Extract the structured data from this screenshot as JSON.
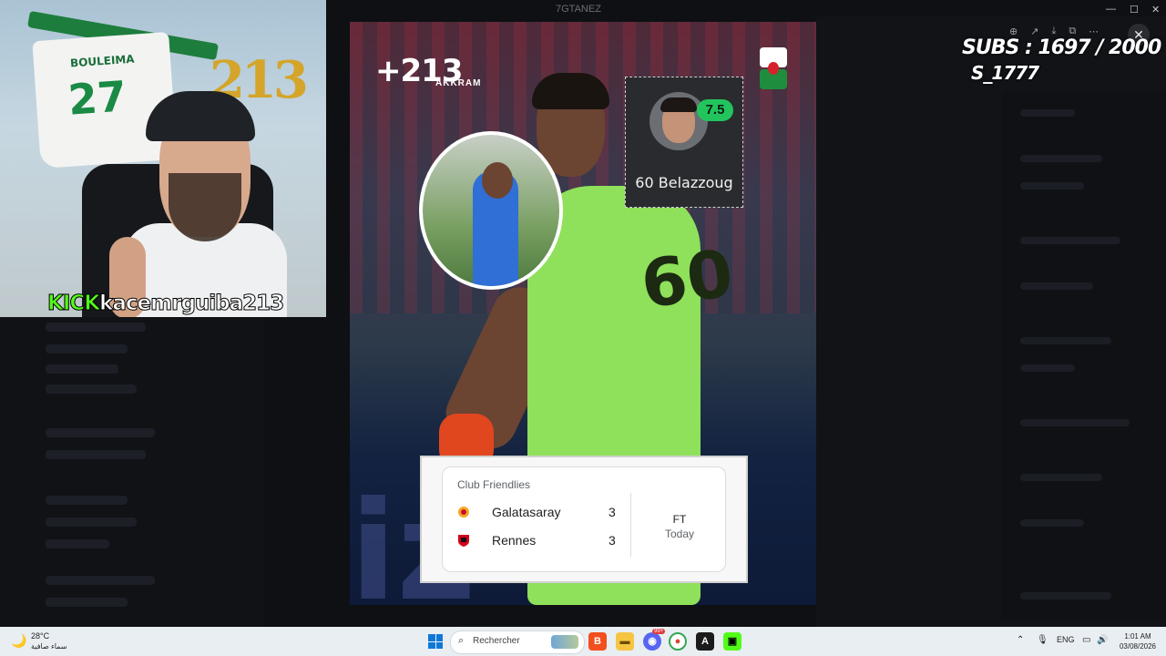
{
  "window": {
    "title": "7GTANEZ"
  },
  "webcam": {
    "jersey_name": "BOULEIMA",
    "jersey_number": "27",
    "balloons_text": "213",
    "kick_brand": "KICK",
    "kick_username": "kacemrguiba213"
  },
  "post": {
    "brand_logo": "+213",
    "brand_sub": "AKKRAM",
    "shirt_number": "60",
    "background_text": "iz",
    "rating": {
      "value": "7.5",
      "player_label": "60 Belazzoug",
      "color": "#22c45e"
    },
    "match": {
      "competition": "Club Friendlies",
      "teams": [
        {
          "name": "Galatasaray",
          "score": "3",
          "icon": "galatasaray-crest-icon"
        },
        {
          "name": "Rennes",
          "score": "3",
          "icon": "rennes-crest-icon"
        }
      ],
      "status": "FT",
      "date": "Today"
    }
  },
  "overlay": {
    "subs": "SUBS : 1697 / 2000",
    "goal_line": "S_1777"
  },
  "taskbar": {
    "weather_temp": "28°C",
    "weather_desc": "سماء صافية",
    "search_placeholder": "Rechercher",
    "notification_badge": "99+",
    "language": "ENG",
    "time": "1:01 AM",
    "date": "03/08/2026"
  },
  "colors": {
    "kick_green": "#53fc18",
    "keeper_kit": "#8fe05a",
    "taskbar_bg": "#e9eef3"
  }
}
